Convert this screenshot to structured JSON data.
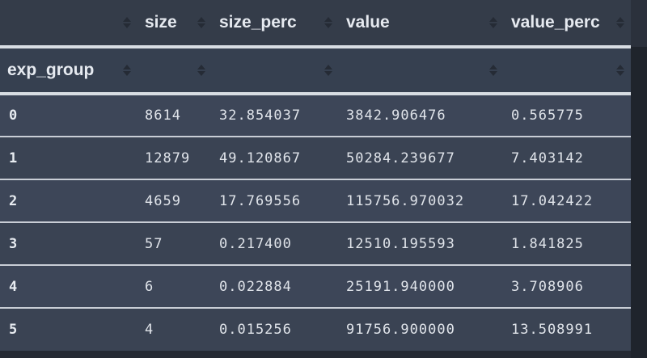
{
  "table": {
    "columns": [
      "",
      "size",
      "size_perc",
      "value",
      "value_perc"
    ],
    "index_name": "exp_group",
    "rows": [
      {
        "index": "0",
        "size": "8614",
        "size_perc": "32.854037",
        "value": "3842.906476",
        "value_perc": "0.565775"
      },
      {
        "index": "1",
        "size": "12879",
        "size_perc": "49.120867",
        "value": "50284.239677",
        "value_perc": "7.403142"
      },
      {
        "index": "2",
        "size": "4659",
        "size_perc": "17.769556",
        "value": "115756.970032",
        "value_perc": "17.042422"
      },
      {
        "index": "3",
        "size": "57",
        "size_perc": "0.217400",
        "value": "12510.195593",
        "value_perc": "1.841825"
      },
      {
        "index": "4",
        "size": "6",
        "size_perc": "0.022884",
        "value": "25191.940000",
        "value_perc": "3.708906"
      },
      {
        "index": "5",
        "size": "4",
        "size_perc": "0.015256",
        "value": "91756.900000",
        "value_perc": "13.508991"
      }
    ]
  },
  "colors": {
    "background": "#252a33",
    "header": "#343c49",
    "row": "#3d4658",
    "divider": "#c9ced6",
    "text": "#e0e4ea"
  },
  "icons": {
    "sort": "sort-arrows-icon"
  }
}
